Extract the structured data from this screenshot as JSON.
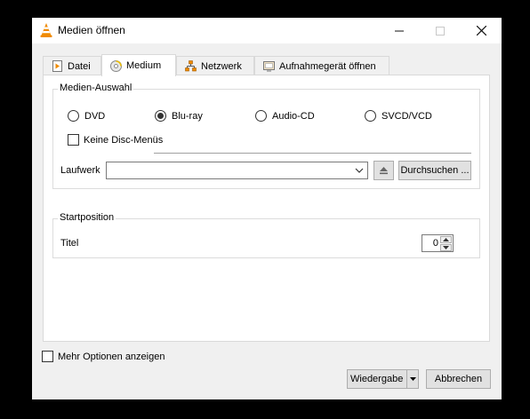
{
  "window": {
    "title": "Medien öffnen"
  },
  "tabs": [
    {
      "label": "Datei",
      "icon": "file-play-icon"
    },
    {
      "label": "Medium",
      "icon": "disc-icon",
      "active": true
    },
    {
      "label": "Netzwerk",
      "icon": "network-icon"
    },
    {
      "label": "Aufnahmegerät öffnen",
      "icon": "capture-device-icon"
    }
  ],
  "media_selection": {
    "group_label": "Medien-Auswahl",
    "options": [
      {
        "label": "DVD",
        "selected": false
      },
      {
        "label": "Blu-ray",
        "selected": true
      },
      {
        "label": "Audio-CD",
        "selected": false
      },
      {
        "label": "SVCD/VCD",
        "selected": false
      }
    ],
    "no_disc_menus": {
      "label": "Keine Disc-Menüs",
      "checked": false
    },
    "drive": {
      "label": "Laufwerk",
      "value": "",
      "eject_icon": "eject-icon"
    },
    "browse_label": "Durchsuchen ..."
  },
  "start_position": {
    "group_label": "Startposition",
    "title_label": "Titel",
    "title_value": "0"
  },
  "footer": {
    "show_more_options": {
      "label": "Mehr Optionen anzeigen",
      "checked": false
    },
    "play_label": "Wiedergabe",
    "cancel_label": "Abbrechen"
  }
}
